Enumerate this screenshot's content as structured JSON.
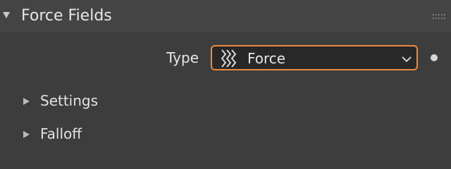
{
  "panel": {
    "title": "Force Fields",
    "expanded": true
  },
  "type_field": {
    "label": "Type",
    "value": "Force",
    "icon": "force-field-icon",
    "accent_color": "#f0893a"
  },
  "subpanels": [
    {
      "label": "Settings",
      "expanded": false
    },
    {
      "label": "Falloff",
      "expanded": false
    }
  ]
}
